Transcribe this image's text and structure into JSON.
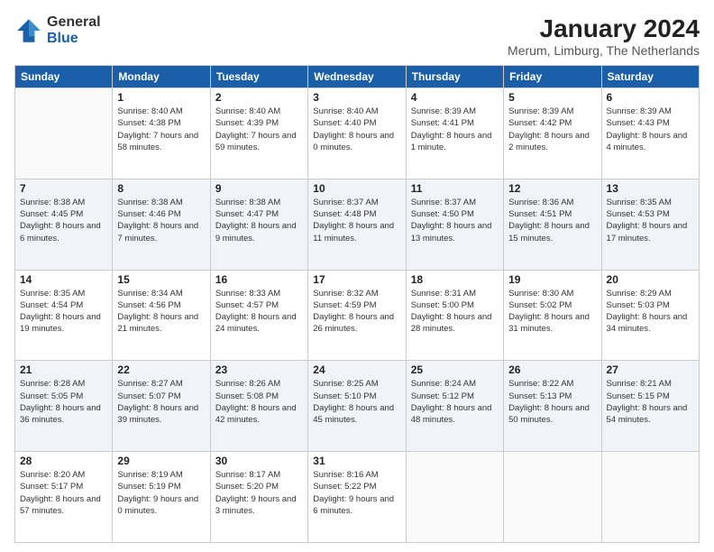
{
  "header": {
    "logo": {
      "line1": "General",
      "line2": "Blue"
    },
    "title": "January 2024",
    "location": "Merum, Limburg, The Netherlands"
  },
  "weekdays": [
    "Sunday",
    "Monday",
    "Tuesday",
    "Wednesday",
    "Thursday",
    "Friday",
    "Saturday"
  ],
  "weeks": [
    [
      {
        "day": "",
        "sunrise": "",
        "sunset": "",
        "daylight": "",
        "empty": true
      },
      {
        "day": "1",
        "sunrise": "Sunrise: 8:40 AM",
        "sunset": "Sunset: 4:38 PM",
        "daylight": "Daylight: 7 hours and 58 minutes."
      },
      {
        "day": "2",
        "sunrise": "Sunrise: 8:40 AM",
        "sunset": "Sunset: 4:39 PM",
        "daylight": "Daylight: 7 hours and 59 minutes."
      },
      {
        "day": "3",
        "sunrise": "Sunrise: 8:40 AM",
        "sunset": "Sunset: 4:40 PM",
        "daylight": "Daylight: 8 hours and 0 minutes."
      },
      {
        "day": "4",
        "sunrise": "Sunrise: 8:39 AM",
        "sunset": "Sunset: 4:41 PM",
        "daylight": "Daylight: 8 hours and 1 minute."
      },
      {
        "day": "5",
        "sunrise": "Sunrise: 8:39 AM",
        "sunset": "Sunset: 4:42 PM",
        "daylight": "Daylight: 8 hours and 2 minutes."
      },
      {
        "day": "6",
        "sunrise": "Sunrise: 8:39 AM",
        "sunset": "Sunset: 4:43 PM",
        "daylight": "Daylight: 8 hours and 4 minutes."
      }
    ],
    [
      {
        "day": "7",
        "sunrise": "Sunrise: 8:38 AM",
        "sunset": "Sunset: 4:45 PM",
        "daylight": "Daylight: 8 hours and 6 minutes."
      },
      {
        "day": "8",
        "sunrise": "Sunrise: 8:38 AM",
        "sunset": "Sunset: 4:46 PM",
        "daylight": "Daylight: 8 hours and 7 minutes."
      },
      {
        "day": "9",
        "sunrise": "Sunrise: 8:38 AM",
        "sunset": "Sunset: 4:47 PM",
        "daylight": "Daylight: 8 hours and 9 minutes."
      },
      {
        "day": "10",
        "sunrise": "Sunrise: 8:37 AM",
        "sunset": "Sunset: 4:48 PM",
        "daylight": "Daylight: 8 hours and 11 minutes."
      },
      {
        "day": "11",
        "sunrise": "Sunrise: 8:37 AM",
        "sunset": "Sunset: 4:50 PM",
        "daylight": "Daylight: 8 hours and 13 minutes."
      },
      {
        "day": "12",
        "sunrise": "Sunrise: 8:36 AM",
        "sunset": "Sunset: 4:51 PM",
        "daylight": "Daylight: 8 hours and 15 minutes."
      },
      {
        "day": "13",
        "sunrise": "Sunrise: 8:35 AM",
        "sunset": "Sunset: 4:53 PM",
        "daylight": "Daylight: 8 hours and 17 minutes."
      }
    ],
    [
      {
        "day": "14",
        "sunrise": "Sunrise: 8:35 AM",
        "sunset": "Sunset: 4:54 PM",
        "daylight": "Daylight: 8 hours and 19 minutes."
      },
      {
        "day": "15",
        "sunrise": "Sunrise: 8:34 AM",
        "sunset": "Sunset: 4:56 PM",
        "daylight": "Daylight: 8 hours and 21 minutes."
      },
      {
        "day": "16",
        "sunrise": "Sunrise: 8:33 AM",
        "sunset": "Sunset: 4:57 PM",
        "daylight": "Daylight: 8 hours and 24 minutes."
      },
      {
        "day": "17",
        "sunrise": "Sunrise: 8:32 AM",
        "sunset": "Sunset: 4:59 PM",
        "daylight": "Daylight: 8 hours and 26 minutes."
      },
      {
        "day": "18",
        "sunrise": "Sunrise: 8:31 AM",
        "sunset": "Sunset: 5:00 PM",
        "daylight": "Daylight: 8 hours and 28 minutes."
      },
      {
        "day": "19",
        "sunrise": "Sunrise: 8:30 AM",
        "sunset": "Sunset: 5:02 PM",
        "daylight": "Daylight: 8 hours and 31 minutes."
      },
      {
        "day": "20",
        "sunrise": "Sunrise: 8:29 AM",
        "sunset": "Sunset: 5:03 PM",
        "daylight": "Daylight: 8 hours and 34 minutes."
      }
    ],
    [
      {
        "day": "21",
        "sunrise": "Sunrise: 8:28 AM",
        "sunset": "Sunset: 5:05 PM",
        "daylight": "Daylight: 8 hours and 36 minutes."
      },
      {
        "day": "22",
        "sunrise": "Sunrise: 8:27 AM",
        "sunset": "Sunset: 5:07 PM",
        "daylight": "Daylight: 8 hours and 39 minutes."
      },
      {
        "day": "23",
        "sunrise": "Sunrise: 8:26 AM",
        "sunset": "Sunset: 5:08 PM",
        "daylight": "Daylight: 8 hours and 42 minutes."
      },
      {
        "day": "24",
        "sunrise": "Sunrise: 8:25 AM",
        "sunset": "Sunset: 5:10 PM",
        "daylight": "Daylight: 8 hours and 45 minutes."
      },
      {
        "day": "25",
        "sunrise": "Sunrise: 8:24 AM",
        "sunset": "Sunset: 5:12 PM",
        "daylight": "Daylight: 8 hours and 48 minutes."
      },
      {
        "day": "26",
        "sunrise": "Sunrise: 8:22 AM",
        "sunset": "Sunset: 5:13 PM",
        "daylight": "Daylight: 8 hours and 50 minutes."
      },
      {
        "day": "27",
        "sunrise": "Sunrise: 8:21 AM",
        "sunset": "Sunset: 5:15 PM",
        "daylight": "Daylight: 8 hours and 54 minutes."
      }
    ],
    [
      {
        "day": "28",
        "sunrise": "Sunrise: 8:20 AM",
        "sunset": "Sunset: 5:17 PM",
        "daylight": "Daylight: 8 hours and 57 minutes."
      },
      {
        "day": "29",
        "sunrise": "Sunrise: 8:19 AM",
        "sunset": "Sunset: 5:19 PM",
        "daylight": "Daylight: 9 hours and 0 minutes."
      },
      {
        "day": "30",
        "sunrise": "Sunrise: 8:17 AM",
        "sunset": "Sunset: 5:20 PM",
        "daylight": "Daylight: 9 hours and 3 minutes."
      },
      {
        "day": "31",
        "sunrise": "Sunrise: 8:16 AM",
        "sunset": "Sunset: 5:22 PM",
        "daylight": "Daylight: 9 hours and 6 minutes."
      },
      {
        "day": "",
        "empty": true
      },
      {
        "day": "",
        "empty": true
      },
      {
        "day": "",
        "empty": true
      }
    ]
  ]
}
